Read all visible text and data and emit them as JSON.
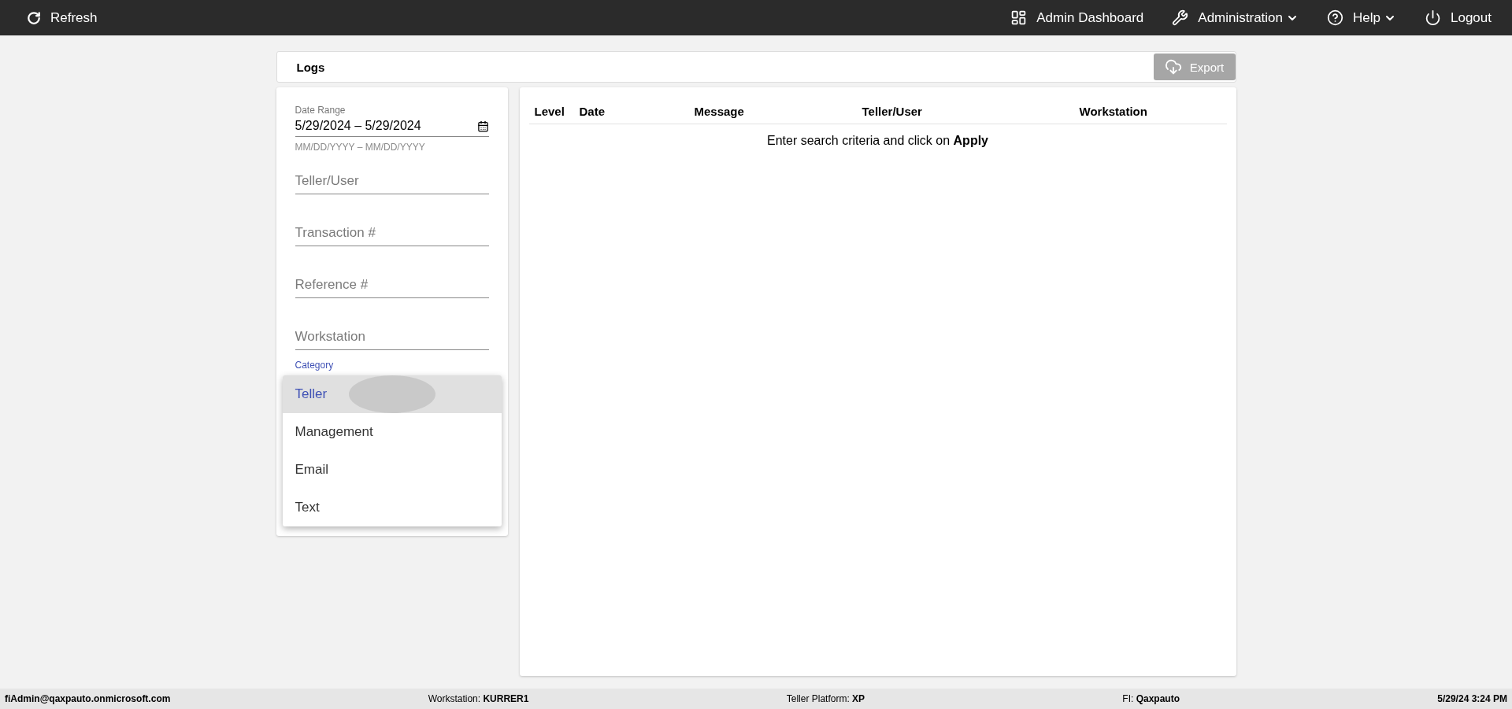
{
  "top_bar": {
    "refresh": "Refresh",
    "items": [
      {
        "label": "Admin Dashboard",
        "has_menu": false
      },
      {
        "label": "Administration",
        "has_menu": true
      },
      {
        "label": "Help",
        "has_menu": true
      },
      {
        "label": "Logout",
        "has_menu": false
      }
    ]
  },
  "header": {
    "title": "Logs",
    "export_button": {
      "label": "Export",
      "disabled": true
    }
  },
  "filters": {
    "date_range": {
      "label": "Date Range",
      "value": "5/29/2024 – 5/29/2024",
      "helper": "MM/DD/YYYY – MM/DD/YYYY"
    },
    "fields": [
      {
        "placeholder": "Teller/User"
      },
      {
        "placeholder": "Transaction #"
      },
      {
        "placeholder": "Reference #"
      },
      {
        "placeholder": "Workstation"
      }
    ],
    "category": {
      "label": "Category"
    }
  },
  "category_menu": [
    {
      "label": "Teller",
      "selected": true
    },
    {
      "label": "Management",
      "selected": false
    },
    {
      "label": "Email",
      "selected": false
    },
    {
      "label": "Text",
      "selected": false
    }
  ],
  "table": {
    "columns": [
      "Level",
      "Date",
      "Message",
      "Teller/User",
      "Workstation"
    ],
    "empty_message": "Enter search criteria and click on **Apply**"
  },
  "status_bar": [
    {
      "value": "fiAdmin@qaxpauto.onmicrosoft.com"
    },
    {
      "label": "Workstation:",
      "value": "KURRER1"
    },
    {
      "label": "Teller Platform:",
      "value": "XP"
    },
    {
      "label": "FI:",
      "value": "Qaxpauto"
    },
    {
      "value": "5/29/24 3:24 PM"
    }
  ]
}
